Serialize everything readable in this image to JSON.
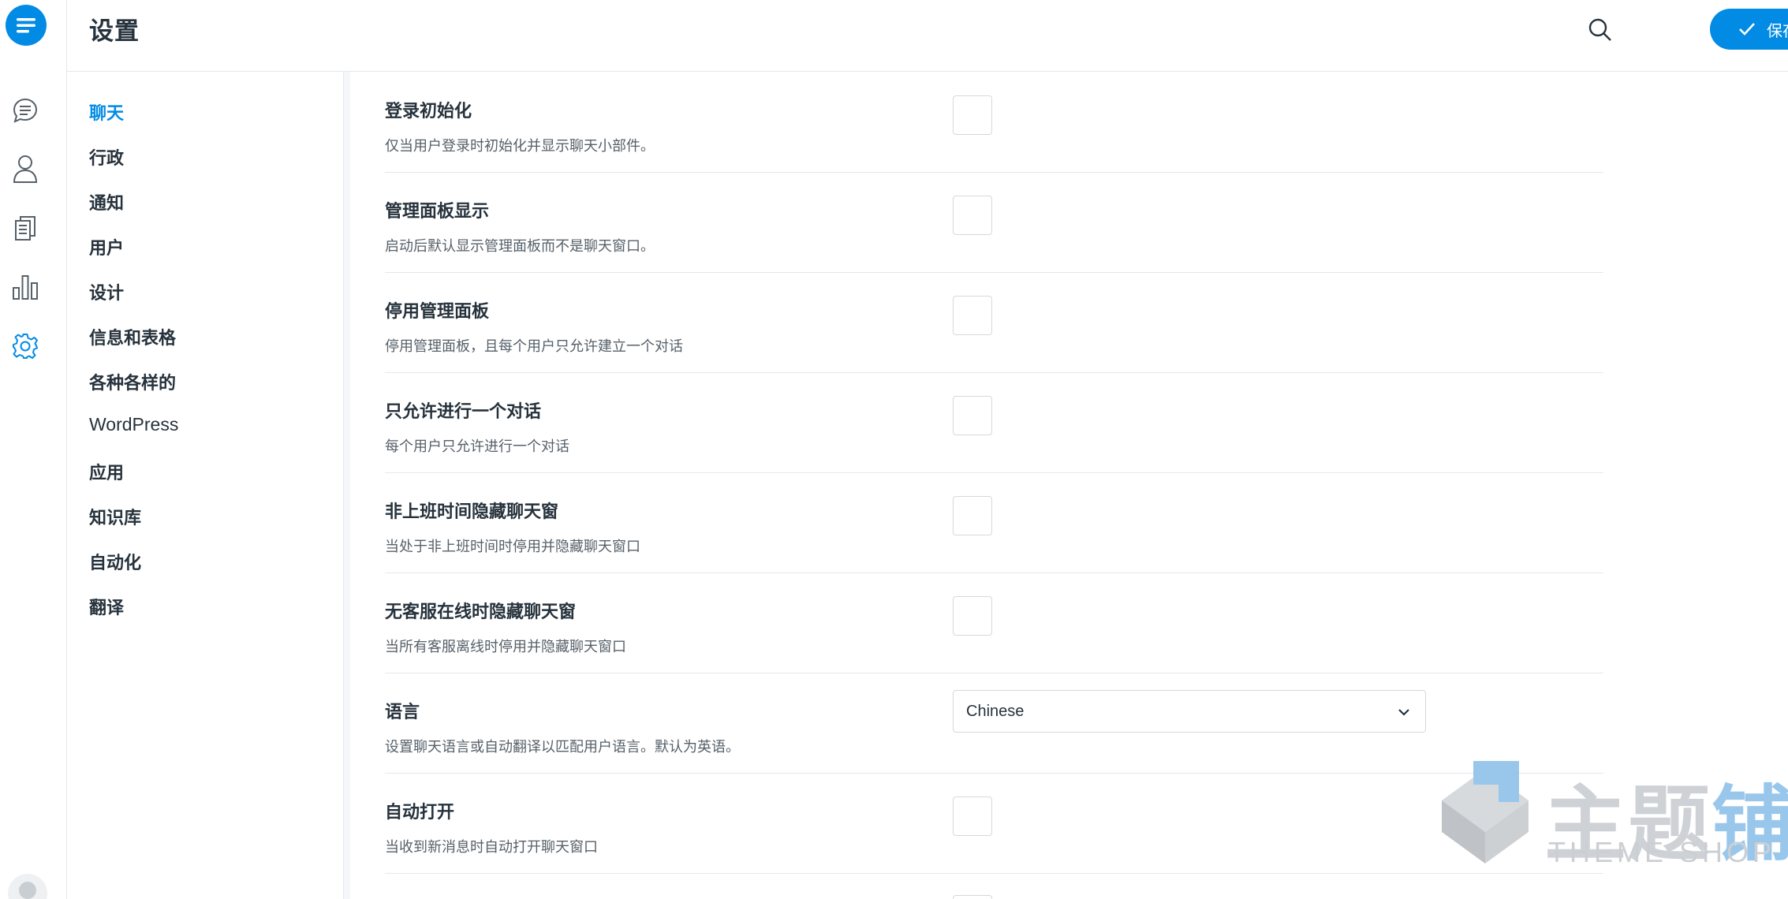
{
  "header": {
    "title": "设置",
    "save_label": "保存更改"
  },
  "nav": {
    "items": [
      {
        "label": "聊天",
        "active": true
      },
      {
        "label": "行政"
      },
      {
        "label": "通知"
      },
      {
        "label": "用户"
      },
      {
        "label": "设计"
      },
      {
        "label": "信息和表格"
      },
      {
        "label": "各种各样的"
      },
      {
        "label": "WordPress"
      },
      {
        "label": "应用"
      },
      {
        "label": "知识库"
      },
      {
        "label": "自动化"
      },
      {
        "label": "翻译"
      }
    ]
  },
  "settings": [
    {
      "title": "登录初始化",
      "desc": "仅当用户登录时初始化并显示聊天小部件。",
      "control": "checkbox",
      "checked": false
    },
    {
      "title": "管理面板显示",
      "desc": "启动后默认显示管理面板而不是聊天窗口。",
      "control": "checkbox",
      "checked": false
    },
    {
      "title": "停用管理面板",
      "desc": "停用管理面板，且每个用户只允许建立一个对话",
      "control": "checkbox",
      "checked": false
    },
    {
      "title": "只允许进行一个对话",
      "desc": "每个用户只允许进行一个对话",
      "control": "checkbox",
      "checked": false
    },
    {
      "title": "非上班时间隐藏聊天窗",
      "desc": "当处于非上班时间时停用并隐藏聊天窗口",
      "control": "checkbox",
      "checked": false
    },
    {
      "title": "无客服在线时隐藏聊天窗",
      "desc": "当所有客服离线时停用并隐藏聊天窗口",
      "control": "checkbox",
      "checked": false
    },
    {
      "title": "语言",
      "desc": "设置聊天语言或自动翻译以匹配用户语言。默认为英语。",
      "control": "select",
      "value": "Chinese"
    },
    {
      "title": "自动打开",
      "desc": "当收到新消息时自动打开聊天窗口",
      "control": "checkbox",
      "checked": false
    }
  ],
  "watermark": {
    "cn_gray": "主题",
    "cn_blue": "铺",
    "en": "THEME SHOP"
  },
  "colors": {
    "accent": "#028be5",
    "text": "#26323c",
    "muted": "#566069",
    "border": "#e4e8ec"
  }
}
